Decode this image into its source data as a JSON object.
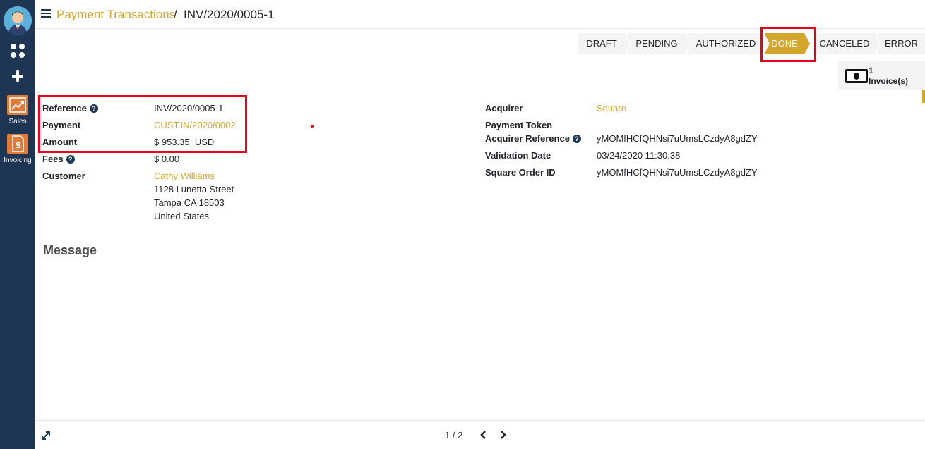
{
  "sidebar": {
    "apps": [
      {
        "label": "Sales",
        "icon": "sales-chart-icon"
      },
      {
        "label": "Invoicing",
        "icon": "invoice-dollar-icon"
      }
    ]
  },
  "breadcrumb": {
    "parent": "Payment Transactions",
    "separator": "/",
    "current": "INV/2020/0005-1"
  },
  "statusbar": {
    "stages": [
      "DRAFT",
      "PENDING",
      "AUTHORIZED",
      "DONE",
      "CANCELED",
      "ERROR"
    ],
    "active": "DONE"
  },
  "smart_button": {
    "count": "1",
    "label": "Invoice(s)",
    "icon": "money-bill-icon"
  },
  "form": {
    "reference_label": "Reference",
    "reference_value": "INV/2020/0005-1",
    "payment_label": "Payment",
    "payment_value": "CUST.IN/2020/0002",
    "amount_label": "Amount",
    "amount_value": "$ 953.35  USD",
    "fees_label": "Fees",
    "fees_value": "$ 0.00",
    "customer_label": "Customer",
    "customer_name": "Cathy Williams",
    "customer_street": "1128 Lunetta Street",
    "customer_city": "Tampa CA 18503",
    "customer_country": "United States",
    "acquirer_label": "Acquirer",
    "acquirer_value": "Square",
    "payment_token_label": "Payment Token",
    "acquirer_ref_label": "Acquirer Reference",
    "acquirer_ref_value": "yMOMfHCfQHNsi7uUmsLCzdyA8gdZY",
    "validation_date_label": "Validation Date",
    "validation_date_value": "03/24/2020 11:30:38",
    "square_order_label": "Square Order ID",
    "square_order_value": "yMOMfHCfQHNsi7uUmsLCzdyA8gdZY",
    "help_glyph": "?"
  },
  "message_section": {
    "title": "Message"
  },
  "pager": {
    "value": "1 / 2"
  },
  "colors": {
    "sidebar": "#1e3553",
    "accent": "#d4a72c",
    "highlight": "#e8001c"
  }
}
